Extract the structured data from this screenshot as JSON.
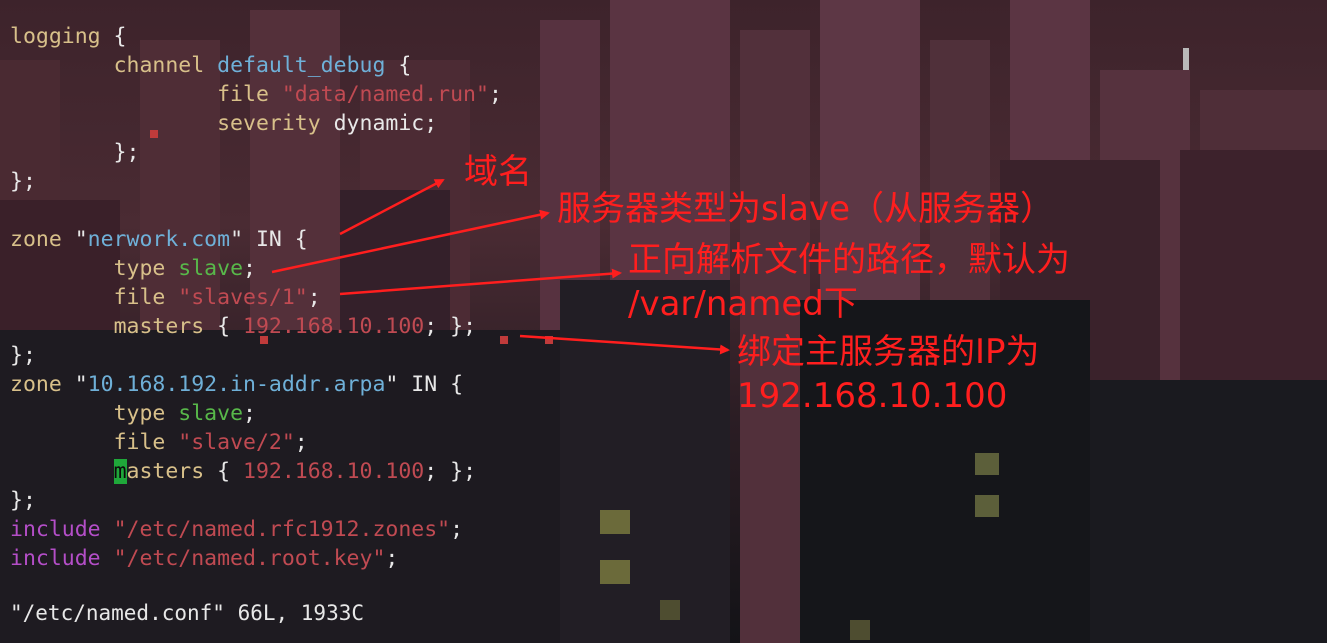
{
  "editor": {
    "lines": [
      [
        {
          "t": "logging",
          "c": "y"
        },
        {
          "t": " {",
          "c": "w"
        }
      ],
      [
        {
          "t": "        ",
          "c": "w"
        },
        {
          "t": "channel",
          "c": "y"
        },
        {
          "t": " ",
          "c": "w"
        },
        {
          "t": "default_debug",
          "c": "id"
        },
        {
          "t": " {",
          "c": "w"
        }
      ],
      [
        {
          "t": "                ",
          "c": "w"
        },
        {
          "t": "file",
          "c": "y"
        },
        {
          "t": " ",
          "c": "w"
        },
        {
          "t": "\"data/named.run\"",
          "c": "str"
        },
        {
          "t": ";",
          "c": "w"
        }
      ],
      [
        {
          "t": "                ",
          "c": "w"
        },
        {
          "t": "severity",
          "c": "y"
        },
        {
          "t": " dynamic;",
          "c": "w"
        }
      ],
      [
        {
          "t": "        };",
          "c": "w"
        }
      ],
      [
        {
          "t": "};",
          "c": "w"
        }
      ],
      [
        {
          "t": "",
          "c": "w"
        }
      ],
      [
        {
          "t": "zone",
          "c": "y"
        },
        {
          "t": " \"",
          "c": "w"
        },
        {
          "t": "nerwork.com",
          "c": "id"
        },
        {
          "t": "\" IN {",
          "c": "w"
        }
      ],
      [
        {
          "t": "        ",
          "c": "w"
        },
        {
          "t": "type",
          "c": "y"
        },
        {
          "t": " ",
          "c": "w"
        },
        {
          "t": "slave",
          "c": "grn"
        },
        {
          "t": ";",
          "c": "w"
        }
      ],
      [
        {
          "t": "        ",
          "c": "w"
        },
        {
          "t": "file",
          "c": "y"
        },
        {
          "t": " ",
          "c": "w"
        },
        {
          "t": "\"slaves/1\"",
          "c": "str"
        },
        {
          "t": ";",
          "c": "w"
        }
      ],
      [
        {
          "t": "        ",
          "c": "w"
        },
        {
          "t": "masters",
          "c": "y"
        },
        {
          "t": " { ",
          "c": "w"
        },
        {
          "t": "192.168.10.100",
          "c": "num"
        },
        {
          "t": "; };",
          "c": "w"
        }
      ],
      [
        {
          "t": "};",
          "c": "w"
        }
      ],
      [
        {
          "t": "zone",
          "c": "y"
        },
        {
          "t": " \"",
          "c": "w"
        },
        {
          "t": "10.168.192.in-addr.arpa",
          "c": "id"
        },
        {
          "t": "\" IN {",
          "c": "w"
        }
      ],
      [
        {
          "t": "        ",
          "c": "w"
        },
        {
          "t": "type",
          "c": "y"
        },
        {
          "t": " ",
          "c": "w"
        },
        {
          "t": "slave",
          "c": "grn"
        },
        {
          "t": ";",
          "c": "w"
        }
      ],
      [
        {
          "t": "        ",
          "c": "w"
        },
        {
          "t": "file",
          "c": "y"
        },
        {
          "t": " ",
          "c": "w"
        },
        {
          "t": "\"slave/2\"",
          "c": "str"
        },
        {
          "t": ";",
          "c": "w"
        }
      ],
      [
        {
          "t": "        ",
          "c": "w"
        },
        {
          "t": "m",
          "c": "cursor"
        },
        {
          "t": "asters",
          "c": "y"
        },
        {
          "t": " { ",
          "c": "w"
        },
        {
          "t": "192.168.10.100",
          "c": "num"
        },
        {
          "t": "; };",
          "c": "w"
        }
      ],
      [
        {
          "t": "};",
          "c": "w"
        }
      ],
      [
        {
          "t": "include",
          "c": "pur"
        },
        {
          "t": " ",
          "c": "w"
        },
        {
          "t": "\"/etc/named.rfc1912.zones\"",
          "c": "str"
        },
        {
          "t": ";",
          "c": "w"
        }
      ],
      [
        {
          "t": "include",
          "c": "pur"
        },
        {
          "t": " ",
          "c": "w"
        },
        {
          "t": "\"/etc/named.root.key\"",
          "c": "str"
        },
        {
          "t": ";",
          "c": "w"
        }
      ],
      [
        {
          "t": "",
          "c": "w"
        }
      ]
    ],
    "status_line": "\"/etc/named.conf\" 66L, 1933C"
  },
  "annotations": {
    "domain": "域名",
    "server_type": "服务器类型为slave（从服务器）",
    "path_line1": "正向解析文件的路径，默认为",
    "path_line2": "/var/named下",
    "master_line1": "绑定主服务器的IP为",
    "master_line2": "192.168.10.100"
  },
  "colors": {
    "annotation": "#ff1e1e",
    "keyword": "#d8c08a",
    "string": "#c04a52",
    "identifier": "#6fb0d8",
    "value": "#58b84a",
    "include": "#b44ec8",
    "cursor": "#1fa83a"
  }
}
